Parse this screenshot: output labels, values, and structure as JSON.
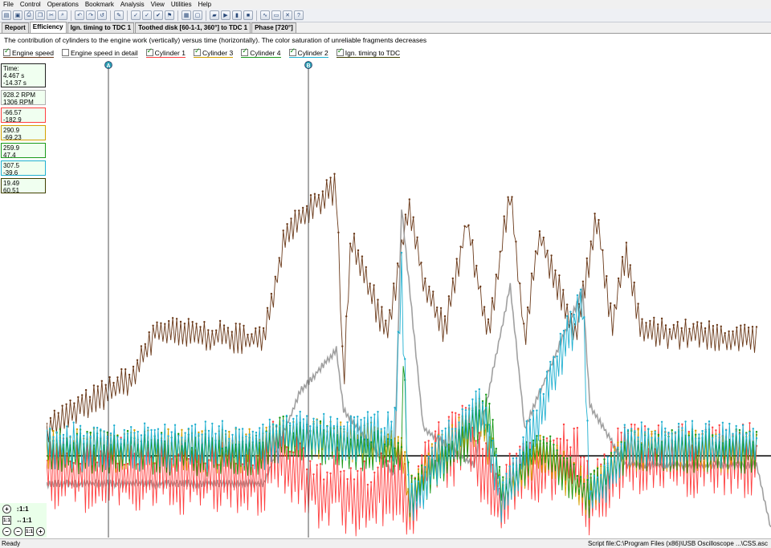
{
  "menu": [
    "File",
    "Control",
    "Operations",
    "Bookmark",
    "Analysis",
    "View",
    "Utilities",
    "Help"
  ],
  "tabs": [
    "Report",
    "Efficiency",
    "Ign. timing to TDC 1",
    "Toothed disk [60-1-1, 360°] to TDC 1",
    "Phase [720°]"
  ],
  "active_tab": "Efficiency",
  "description": "The contribution of cylinders to the engine work (vertically) versus time (horizontally). The color saturation of unreliable fragments decreases",
  "legend": [
    {
      "label": "Engine speed",
      "checked": true,
      "color": "#6b3a1a"
    },
    {
      "label": "Engine speed in detail",
      "checked": false,
      "color": "#a0a0a0"
    },
    {
      "label": "Cylinder 1",
      "checked": true,
      "color": "#ff4040"
    },
    {
      "label": "Cylinder 3",
      "checked": true,
      "color": "#d4a000"
    },
    {
      "label": "Cylinder 4",
      "checked": true,
      "color": "#1a9a1a"
    },
    {
      "label": "Cylinder 2",
      "checked": true,
      "color": "#20b0d0"
    },
    {
      "label": "Ign. timing to TDC",
      "checked": true,
      "color": "#404000"
    }
  ],
  "readouts": {
    "time": {
      "label": "Time:",
      "a": "4.467 s",
      "b": "-14.37 s"
    },
    "engine_speed": {
      "a": "928.2 RPM",
      "b": "1306 RPM",
      "color": "#6b3a1a"
    },
    "cyl1": {
      "a": "-66.57",
      "b": "-182.9",
      "color": "#ff4040"
    },
    "cyl3": {
      "a": "290.9",
      "b": "-69.23",
      "color": "#d4a000"
    },
    "cyl4": {
      "a": "259.9",
      "b": "47.4",
      "color": "#1a9a1a"
    },
    "cyl2": {
      "a": "307.5",
      "b": "-39.6",
      "color": "#20b0d0"
    },
    "ign": {
      "a": "19.49",
      "b": "60.51",
      "color": "#404000"
    }
  },
  "cursors": {
    "a_label": "A",
    "b_label": "B"
  },
  "zoom": {
    "y": "↕1:1",
    "x": "↔1:1"
  },
  "status": {
    "left": "Ready",
    "right": "Script file:C:\\Program Files (x86)\\USB Oscilloscope ...\\CSS.asc"
  },
  "chart_data": {
    "type": "line",
    "grid": false,
    "series": [
      {
        "name": "Engine speed",
        "color": "#6b3a1a",
        "keypoints": [
          [
            0,
            0.22
          ],
          [
            0.12,
            0.33
          ],
          [
            0.15,
            0.43
          ],
          [
            0.3,
            0.41
          ],
          [
            0.33,
            0.65
          ],
          [
            0.38,
            0.72
          ],
          [
            0.4,
            0.74
          ],
          [
            0.41,
            0.31
          ],
          [
            0.42,
            0.63
          ],
          [
            0.47,
            0.42
          ],
          [
            0.5,
            0.7
          ],
          [
            0.52,
            0.54
          ],
          [
            0.55,
            0.43
          ],
          [
            0.58,
            0.67
          ],
          [
            0.61,
            0.42
          ],
          [
            0.64,
            0.74
          ],
          [
            0.66,
            0.41
          ],
          [
            0.68,
            0.64
          ],
          [
            0.73,
            0.42
          ],
          [
            0.76,
            0.68
          ],
          [
            0.78,
            0.44
          ],
          [
            0.8,
            0.6
          ],
          [
            0.82,
            0.43
          ],
          [
            0.98,
            0.41
          ]
        ]
      },
      {
        "name": "Engine speed in detail",
        "color": "#a0a0a0",
        "keypoints": [
          [
            0,
            0.1
          ],
          [
            0.3,
            0.1
          ],
          [
            0.35,
            0.3
          ],
          [
            0.4,
            0.39
          ],
          [
            0.41,
            0.26
          ],
          [
            0.48,
            0.12
          ],
          [
            0.49,
            0.7
          ],
          [
            0.52,
            0.22
          ],
          [
            0.59,
            0.14
          ],
          [
            0.64,
            0.53
          ],
          [
            0.66,
            0.22
          ],
          [
            0.74,
            0.52
          ],
          [
            0.75,
            0.27
          ],
          [
            0.8,
            0.14
          ],
          [
            0.98,
            0.14
          ],
          [
            1.0,
            0.0
          ]
        ]
      },
      {
        "name": "Cylinder 1",
        "color": "#ff4040",
        "keypoints": [
          [
            0,
            0.12
          ],
          [
            0.3,
            0.11
          ],
          [
            0.31,
            0.17
          ],
          [
            0.38,
            0.08
          ],
          [
            0.4,
            0.1
          ],
          [
            0.42,
            0.06
          ],
          [
            0.49,
            0.1
          ],
          [
            0.5,
            0.05
          ],
          [
            0.53,
            0.15
          ],
          [
            0.58,
            0.19
          ],
          [
            0.63,
            0.05
          ],
          [
            0.65,
            0.13
          ],
          [
            0.73,
            0.15
          ],
          [
            0.75,
            0.06
          ],
          [
            0.79,
            0.15
          ],
          [
            0.98,
            0.15
          ]
        ]
      },
      {
        "name": "Cylinder 3",
        "color": "#d4a000",
        "keypoints": [
          [
            0,
            0.17
          ],
          [
            0.3,
            0.17
          ],
          [
            0.31,
            0.2
          ],
          [
            0.49,
            0.18
          ],
          [
            0.5,
            0.06
          ],
          [
            0.53,
            0.15
          ],
          [
            0.6,
            0.24
          ],
          [
            0.63,
            0.07
          ],
          [
            0.68,
            0.17
          ],
          [
            0.75,
            0.07
          ],
          [
            0.8,
            0.17
          ],
          [
            0.98,
            0.17
          ]
        ]
      },
      {
        "name": "Cylinder 4",
        "color": "#1a9a1a",
        "keypoints": [
          [
            0,
            0.17
          ],
          [
            0.3,
            0.16
          ],
          [
            0.32,
            0.2
          ],
          [
            0.49,
            0.16
          ],
          [
            0.49,
            0.5
          ],
          [
            0.5,
            0.07
          ],
          [
            0.55,
            0.15
          ],
          [
            0.61,
            0.25
          ],
          [
            0.63,
            0.07
          ],
          [
            0.68,
            0.18
          ],
          [
            0.75,
            0.07
          ],
          [
            0.8,
            0.17
          ],
          [
            0.98,
            0.17
          ]
        ]
      },
      {
        "name": "Cylinder 2",
        "color": "#20b0d0",
        "keypoints": [
          [
            0,
            0.18
          ],
          [
            0.3,
            0.18
          ],
          [
            0.32,
            0.2
          ],
          [
            0.48,
            0.2
          ],
          [
            0.49,
            0.55
          ],
          [
            0.5,
            0.05
          ],
          [
            0.55,
            0.17
          ],
          [
            0.6,
            0.27
          ],
          [
            0.63,
            0.05
          ],
          [
            0.66,
            0.17
          ],
          [
            0.74,
            0.5
          ],
          [
            0.75,
            0.06
          ],
          [
            0.8,
            0.18
          ],
          [
            0.98,
            0.18
          ]
        ]
      }
    ]
  }
}
